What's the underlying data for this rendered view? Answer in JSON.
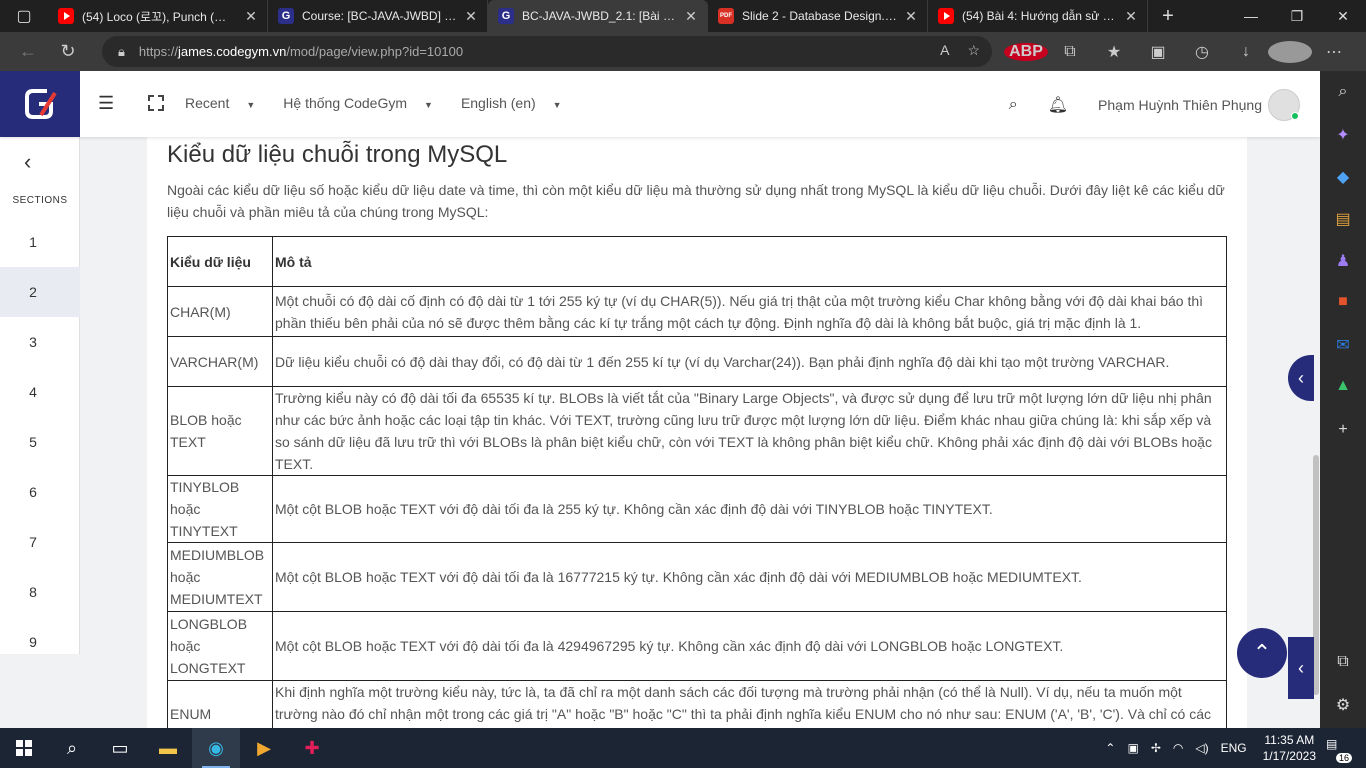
{
  "browser": {
    "tabs": [
      {
        "title": "(54) Loco (로꼬), Punch (펀치) - Say Yes",
        "icon": "youtube-icon",
        "active": false
      },
      {
        "title": "Course: [BC-JAVA-JWBD] Java Back",
        "icon": "codegym-icon",
        "active": false
      },
      {
        "title": "BC-JAVA-JWBD_2.1: [Bài đọc]",
        "icon": "codegym-icon",
        "active": true
      },
      {
        "title": "Slide 2 - Database Design.pdf",
        "icon": "pdf-icon",
        "active": false
      },
      {
        "title": "(54) Bài 4: Hướng dẫn sử dụng",
        "icon": "youtube-icon",
        "active": false
      }
    ],
    "url_prefix": "https://",
    "url_host": "james.codegym.vn",
    "url_path": "/mod/page/view.php?id=10100",
    "abp_label": "ABP"
  },
  "topnav": {
    "menu": [
      "Recent",
      "Hệ thống CodeGym",
      "English (en)"
    ],
    "user_name": "Phạm Huỳnh Thiên Phụng"
  },
  "rail": {
    "sections_label": "SECTIONS",
    "numbers": [
      "1",
      "2",
      "3",
      "4",
      "5",
      "6",
      "7",
      "8",
      "9"
    ],
    "active": "2"
  },
  "content": {
    "heading": "Kiểu dữ liệu chuỗi trong MySQL",
    "intro": "Ngoài các kiểu dữ liệu số hoặc kiểu dữ liệu date và time, thì còn một kiểu dữ liệu mà thường sử dụng nhất trong MySQL là kiểu dữ liệu chuỗi. Dưới đây liệt kê các kiểu dữ liệu chuỗi và phần miêu tả của chúng trong MySQL:",
    "table_headers": [
      "Kiểu dữ liệu",
      "Mô tả"
    ],
    "rows": [
      {
        "type": "CHAR(M)",
        "desc": "Một chuỗi có độ dài cố định có độ dài từ 1 tới 255 ký tự (ví dụ CHAR(5)). Nếu giá trị thật của một trường kiểu Char không bằng với độ dài khai báo thì phần thiếu bên phải của nó sẽ được thêm bằng các kí tự trắng một cách tự động. Định nghĩa độ dài là không bắt buộc, giá trị mặc định là 1."
      },
      {
        "type": "VARCHAR(M)",
        "desc": "Dữ liệu kiểu chuỗi có độ dài thay đổi, có độ dài từ 1 đến 255 kí tự (ví dụ Varchar(24)). Bạn phải định nghĩa độ dài khi tạo một trường VARCHAR."
      },
      {
        "type": "BLOB hoặc TEXT",
        "desc": "Trường kiểu này có độ dài tối đa 65535 kí tự. BLOBs là viết tắt của \"Binary Large Objects\", và được sử dụng để lưu trữ một lượng lớn dữ liệu nhị phân như các bức ảnh hoặc các loại tập tin khác. Với TEXT, trường cũng lưu trữ được một lượng lớn dữ liệu. Điểm khác nhau giữa chúng là: khi sắp xếp và so sánh dữ liệu đã lưu trữ thì với BLOBs là phân biệt kiểu chữ, còn với TEXT là không phân biệt kiểu chữ. Không phải xác định độ dài với BLOBs hoặc TEXT."
      },
      {
        "type": "TINYBLOB hoặc TINYTEXT",
        "desc": "Một cột BLOB hoặc TEXT với độ dài tối đa là 255 ký tự. Không cần xác định độ dài với TINYBLOB hoặc TINYTEXT."
      },
      {
        "type": "MEDIUMBLOB hoặc MEDIUMTEXT",
        "desc": "Một cột BLOB hoặc TEXT với độ dài tối đa là 16777215 ký tự. Không cần xác định độ dài với MEDIUMBLOB hoặc MEDIUMTEXT."
      },
      {
        "type": "LONGBLOB hoặc LONGTEXT",
        "desc": "Một cột BLOB hoặc TEXT với độ dài tối đa là 4294967295 ký tự. Không cần xác định độ dài với LONGBLOB hoặc LONGTEXT."
      },
      {
        "type": "ENUM",
        "desc": "Khi định nghĩa một trường kiểu này, tức là, ta đã chỉ ra một danh sách các đối tượng mà trường phải nhận (có thể là Null). Ví dụ, nếu ta muốn một trường nào đó chỉ nhận một trong các giá trị \"A\" hoặc \"B\" hoặc \"C\" thì ta phải định nghĩa kiểu ENUM cho nó như sau: ENUM ('A', 'B', 'C'). Và chỉ có các giá trị này (hoặc NULL) có thể xuất hiện trong trường đó."
      }
    ]
  },
  "taskbar": {
    "lang": "ENG",
    "time": "11:35 AM",
    "date": "1/17/2023",
    "notif_count": "16"
  },
  "colors": {
    "brand": "#262c7a",
    "online": "#16c060"
  }
}
